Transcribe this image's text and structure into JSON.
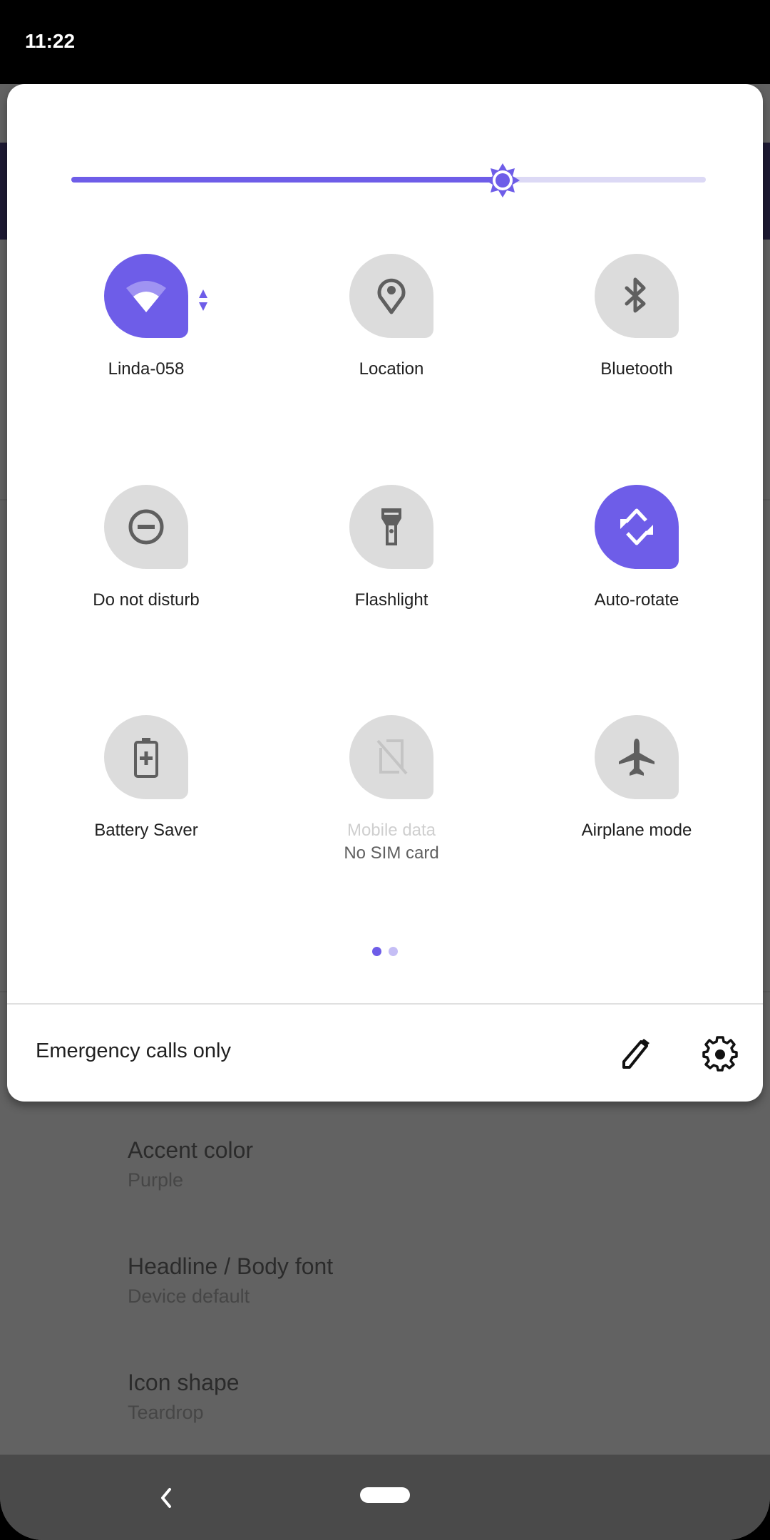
{
  "status_bar": {
    "time": "11:22"
  },
  "colors": {
    "accent": "#6e5de8",
    "accent_light": "#dcd9f5",
    "tile_off": "#dcdcdc",
    "icon_off": "#5f5f5f"
  },
  "quick_settings": {
    "brightness": {
      "level": 0.68,
      "icon": "brightness-icon"
    },
    "tiles": [
      {
        "id": "wifi",
        "label": "Linda-058",
        "icon": "wifi-icon",
        "state": "on"
      },
      {
        "id": "location",
        "label": "Location",
        "icon": "location-pin-icon",
        "state": "off"
      },
      {
        "id": "bluetooth",
        "label": "Bluetooth",
        "icon": "bluetooth-icon",
        "state": "off"
      },
      {
        "id": "dnd",
        "label": "Do not disturb",
        "icon": "do-not-disturb-icon",
        "state": "off"
      },
      {
        "id": "flashlight",
        "label": "Flashlight",
        "icon": "flashlight-icon",
        "state": "off"
      },
      {
        "id": "autorotate",
        "label": "Auto-rotate",
        "icon": "auto-rotate-icon",
        "state": "on"
      },
      {
        "id": "battery",
        "label": "Battery Saver",
        "icon": "battery-saver-icon",
        "state": "off"
      },
      {
        "id": "mobiledata",
        "label": "Mobile data",
        "sublabel": "No SIM card",
        "icon": "no-sim-icon",
        "state": "unavailable"
      },
      {
        "id": "airplane",
        "label": "Airplane mode",
        "icon": "airplane-icon",
        "state": "off"
      }
    ],
    "pages": {
      "current": 1,
      "total": 2
    },
    "footer": {
      "carrier_text": "Emergency calls only",
      "edit_icon": "pencil-icon",
      "settings_icon": "gear-icon"
    }
  },
  "background_app": {
    "items": [
      {
        "title": "Accent color",
        "subtitle": "Purple"
      },
      {
        "title": "Headline / Body font",
        "subtitle": "Device default"
      },
      {
        "title": "Icon shape",
        "subtitle": "Teardrop"
      }
    ]
  },
  "nav_bar": {
    "back_icon": "back-chevron-icon",
    "home_icon": "home-pill-icon"
  }
}
